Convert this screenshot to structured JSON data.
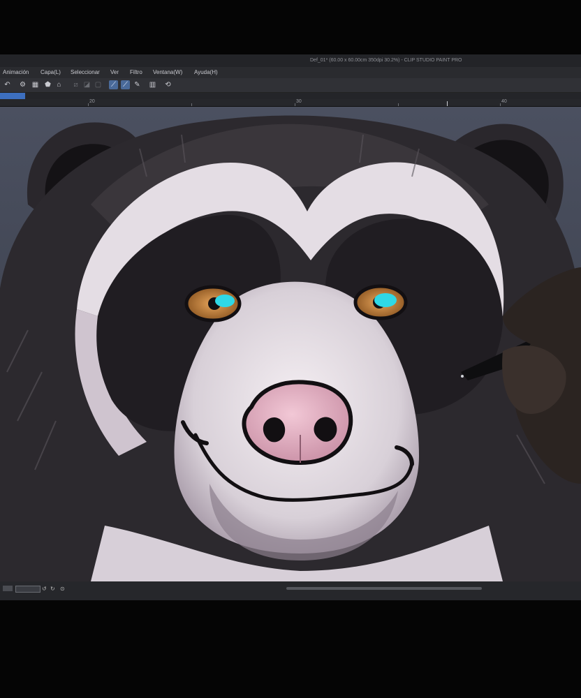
{
  "window": {
    "title": "Def_01* (60.00 x 60.00cm 350dpi 30.2%) - CLIP STUDIO PAINT PRO"
  },
  "menu": {
    "items": [
      {
        "label": "Animación"
      },
      {
        "label": "Capa(L)"
      },
      {
        "label": "Seleccionar"
      },
      {
        "label": "Ver"
      },
      {
        "label": "Filtro"
      },
      {
        "label": "Ventana(W)"
      },
      {
        "label": "Ayuda(H)"
      }
    ]
  },
  "ruler": {
    "labels": [
      "20",
      "30",
      "40"
    ]
  },
  "toolbar": {
    "icons": [
      "undo-icon",
      "settings-gear-icon",
      "grid-icon",
      "fill-icon",
      "transform-icon",
      "hide-selection-icon",
      "clear-icon",
      "fill-selection-icon",
      "selection-mode-icon",
      "snap-to-ruler-icon",
      "snap-to-guide-icon",
      "ruler-pen-icon",
      "layer-property-icon",
      "rotate-icon"
    ]
  },
  "colors": {
    "accent": "#3d6fbf",
    "eye": "#2fd8e6"
  }
}
